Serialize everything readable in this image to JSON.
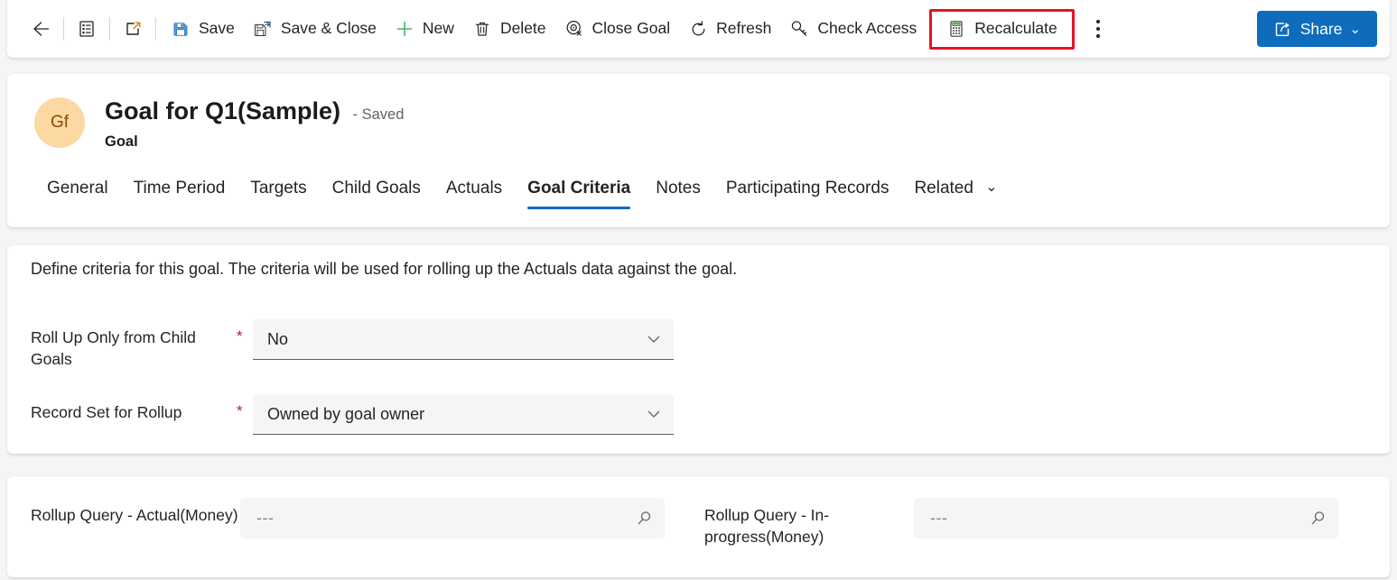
{
  "colors": {
    "accent": "#0f6cbd",
    "highlight": "#e81123",
    "required": "#a4262c",
    "avatar_bg": "#fcd9a2",
    "avatar_fg": "#8a4b08",
    "page_bg": "#f5f5f5",
    "field_bg": "#f5f5f5"
  },
  "commandbar": {
    "back": {
      "label": "",
      "icon": "back-arrow-icon"
    },
    "form_selector": {
      "label": "",
      "icon": "form-list-icon"
    },
    "popout": {
      "label": "",
      "icon": "popout-icon"
    },
    "buttons": [
      {
        "label": "Save",
        "icon": "save-icon"
      },
      {
        "label": "Save & Close",
        "icon": "save-and-close-icon"
      },
      {
        "label": "New",
        "icon": "plus-icon"
      },
      {
        "label": "Delete",
        "icon": "trash-icon"
      },
      {
        "label": "Close Goal",
        "icon": "close-goal-icon"
      },
      {
        "label": "Refresh",
        "icon": "refresh-icon"
      },
      {
        "label": "Check Access",
        "icon": "key-icon"
      }
    ],
    "recalculate": {
      "label": "Recalculate",
      "icon": "calculator-icon",
      "highlighted": true
    },
    "overflow": {
      "label": "",
      "icon": "more-vertical-icon"
    },
    "share": {
      "label": "Share",
      "icon": "share-icon",
      "chevron": "⌄"
    }
  },
  "record": {
    "avatar_initials": "Gf",
    "title": "Goal for Q1(Sample)",
    "saved_status": "- Saved",
    "entity": "Goal"
  },
  "tabs": [
    {
      "label": "General",
      "active": false
    },
    {
      "label": "Time Period",
      "active": false
    },
    {
      "label": "Targets",
      "active": false
    },
    {
      "label": "Child Goals",
      "active": false
    },
    {
      "label": "Actuals",
      "active": false
    },
    {
      "label": "Goal Criteria",
      "active": true
    },
    {
      "label": "Notes",
      "active": false
    },
    {
      "label": "Participating Records",
      "active": false
    },
    {
      "label": "Related",
      "active": false,
      "chevron": "⌄"
    }
  ],
  "criteria": {
    "description": "Define criteria for this goal. The criteria will be used for rolling up the Actuals data against the goal.",
    "fields": [
      {
        "label": "Roll Up Only from Child Goals",
        "required": "*",
        "value": "No",
        "chevron": "⌄"
      },
      {
        "label": "Record Set for Rollup",
        "required": "*",
        "value": "Owned by goal owner",
        "chevron": "⌄"
      }
    ]
  },
  "rollup": {
    "fields": [
      {
        "label": "Rollup Query - Actual(Money)",
        "value": "---",
        "placeholder": "---",
        "icon": "search-icon"
      },
      {
        "label": "Rollup Query - In-progress(Money)",
        "value": "---",
        "placeholder": "---",
        "icon": "search-icon"
      }
    ]
  }
}
